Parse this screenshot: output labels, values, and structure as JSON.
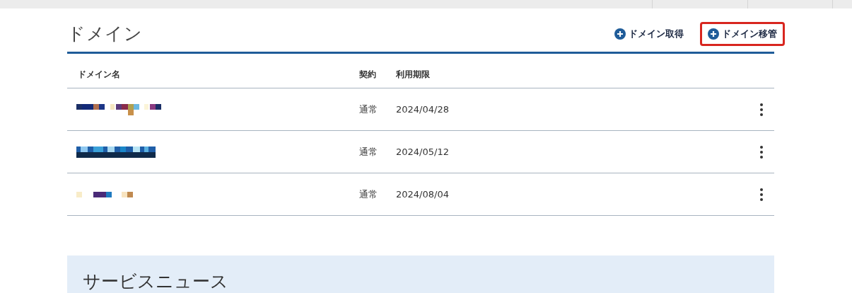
{
  "section": {
    "title": "ドメイン",
    "actions": [
      {
        "label": "ドメイン取得",
        "highlighted": false
      },
      {
        "label": "ドメイン移管",
        "highlighted": true
      }
    ]
  },
  "table": {
    "columns": [
      "ドメイン名",
      "契約",
      "利用期限"
    ],
    "rows": [
      {
        "contract": "通常",
        "expiry": "2024/04/28"
      },
      {
        "contract": "通常",
        "expiry": "2024/05/12"
      },
      {
        "contract": "通常",
        "expiry": "2024/08/04"
      }
    ]
  },
  "news": {
    "title": "サービスニュース"
  }
}
